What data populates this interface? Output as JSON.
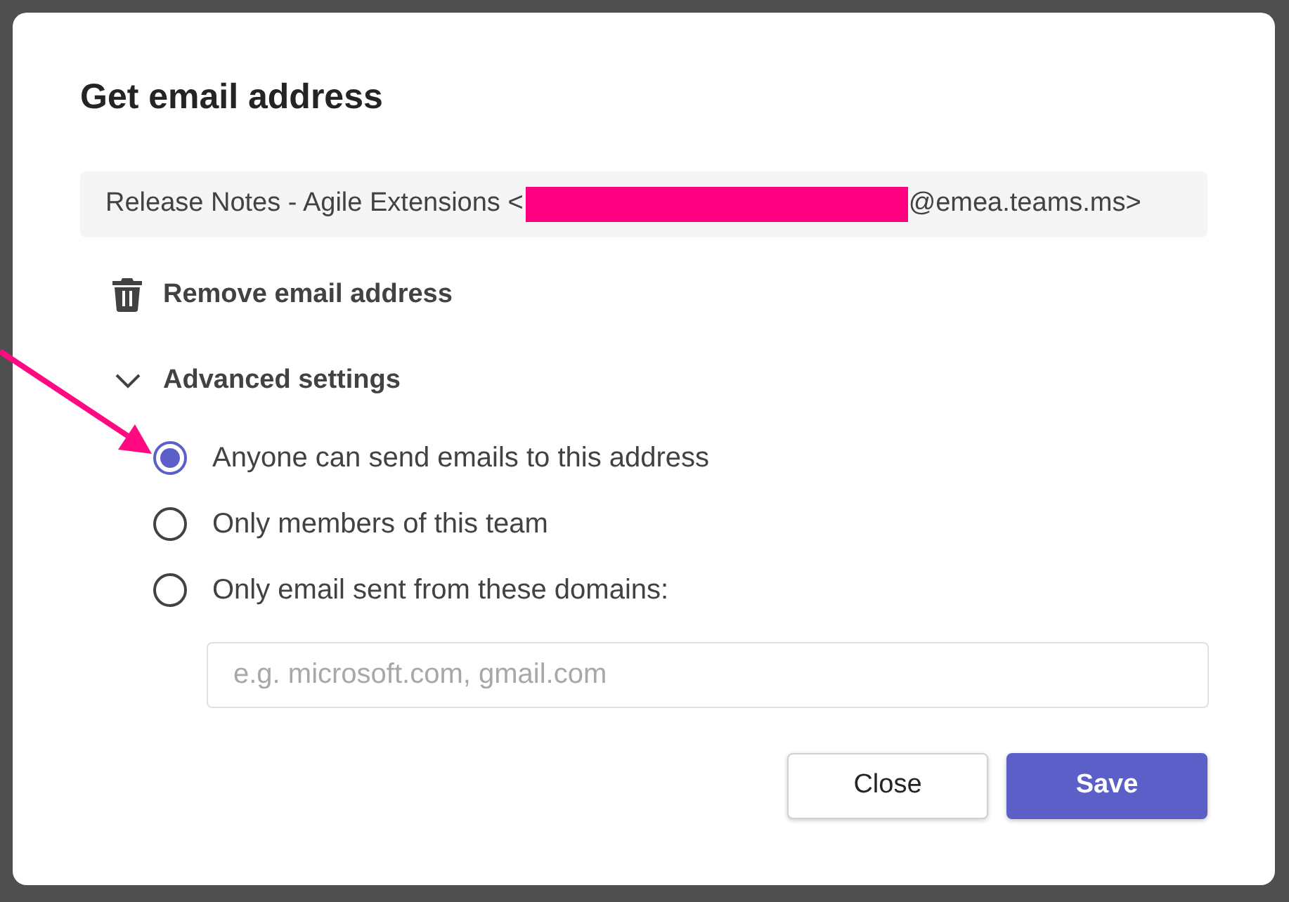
{
  "dialog": {
    "title": "Get email address",
    "email_address": {
      "prefix": "Release Notes - Agile Extensions <",
      "suffix": "@emea.teams.ms>"
    },
    "remove_link": {
      "label": "Remove email address"
    },
    "advanced_settings": {
      "label": "Advanced settings",
      "expanded": true
    },
    "sender_options": [
      {
        "label": "Anyone can send emails to this address",
        "selected": true
      },
      {
        "label": "Only members of this team",
        "selected": false
      },
      {
        "label": "Only email sent from these domains:",
        "selected": false
      }
    ],
    "domains_field": {
      "placeholder": "e.g. microsoft.com, gmail.com"
    },
    "buttons": [
      {
        "label": "Close",
        "kind": "secondary"
      },
      {
        "label": "Save",
        "kind": "primary"
      }
    ]
  }
}
